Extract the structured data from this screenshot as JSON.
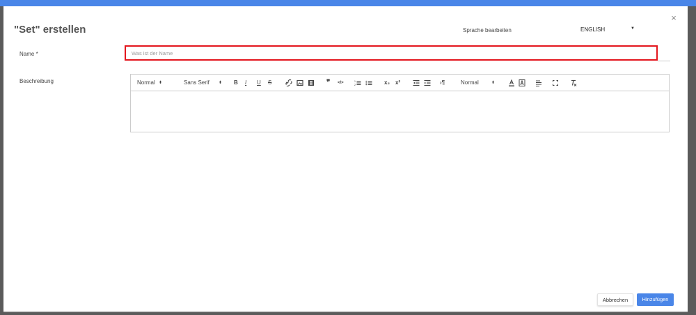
{
  "dialog": {
    "title": "\"Set\" erstellen",
    "close_label": "×",
    "language_label": "Sprache bearbeiten",
    "language_value": "ENGLISH",
    "language_caret": "▼"
  },
  "form": {
    "name_label": "Name *",
    "name_placeholder": "Was ist der Name",
    "name_value": "",
    "description_label": "Beschreibung"
  },
  "toolbar": {
    "header_picker": "Normal",
    "font_picker": "Sans Serif",
    "size_picker": "Normal",
    "picker_caret": "⬍",
    "bold": "B",
    "italic": "I",
    "underline": "U",
    "strike": "S",
    "code": "</>",
    "blockquote": "❞",
    "subscript": "x₂",
    "superscript": "x²",
    "direction": "›¶"
  },
  "footer": {
    "cancel_label": "Abbrechen",
    "add_label": "Hinzufügen"
  },
  "colors": {
    "accent": "#4a86e8",
    "highlight_border": "#e3161d",
    "backdrop": "#5b5b5b"
  }
}
